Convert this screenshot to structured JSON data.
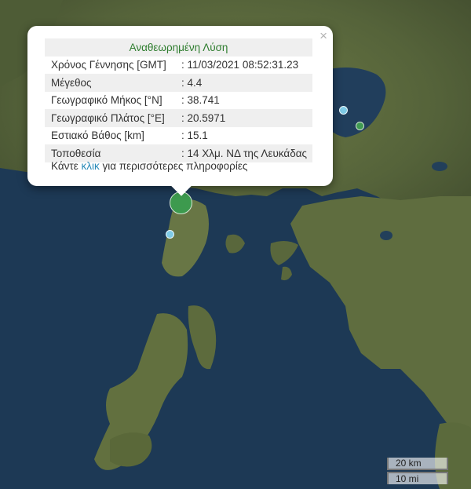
{
  "popup": {
    "title": "Αναθεωρημένη Λύση",
    "rows": [
      {
        "label": "Χρόνος Γέννησης [GMT]",
        "value": ": 11/03/2021 08:52:31.23"
      },
      {
        "label": "Μέγεθος",
        "value": ": 4.4"
      },
      {
        "label": "Γεωγραφικό Μήκος [°N]",
        "value": ": 38.741"
      },
      {
        "label": "Γεωγραφικό Πλάτος [°E]",
        "value": ": 20.5971"
      },
      {
        "label": "Εστιακό Βάθος [km]",
        "value": ": 15.1"
      },
      {
        "label": "Τοποθεσία",
        "value": ": 14 Χλμ. ΝΔ της Λευκάδας"
      }
    ],
    "more_before": "Κάντε",
    "more_link": "κλικ",
    "more_after": "για περισσότερες πληροφορίες",
    "close_symbol": "×"
  },
  "scale": {
    "km": "20 km",
    "mi": "10 mi"
  },
  "markers": [
    {
      "name": "event-selected",
      "color": "#3d9a4e"
    },
    {
      "name": "event-1",
      "color": "#7fcbe6"
    },
    {
      "name": "event-2",
      "color": "#3f9a52"
    },
    {
      "name": "event-3",
      "color": "#7fcbe6"
    }
  ]
}
